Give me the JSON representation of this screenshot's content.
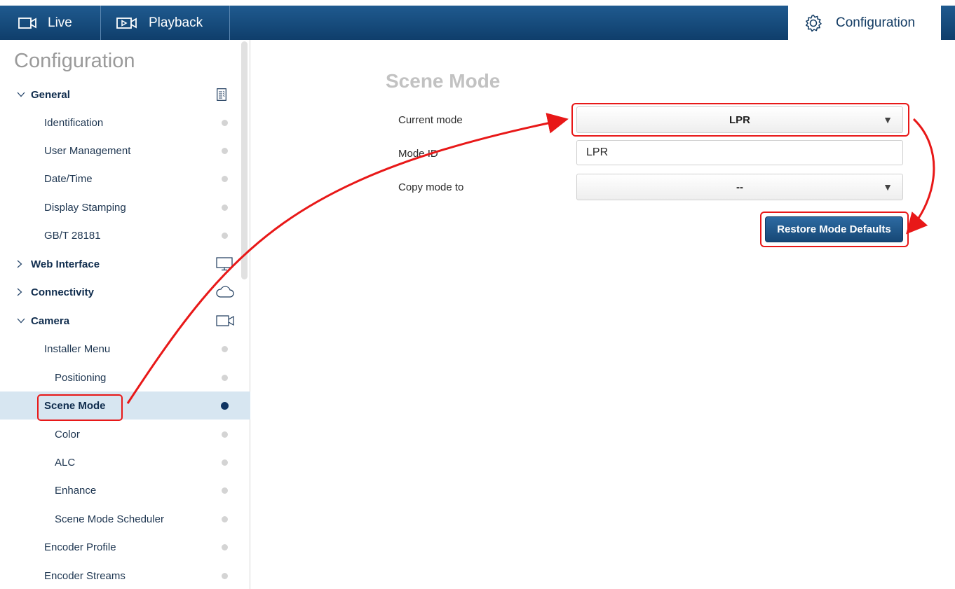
{
  "topbar": {
    "live_label": "Live",
    "playback_label": "Playback",
    "configuration_label": "Configuration"
  },
  "sidebar": {
    "title": "Configuration",
    "items": [
      {
        "label": "General",
        "type": "section",
        "expanded": true,
        "icon": "list-icon"
      },
      {
        "label": "Identification",
        "type": "item",
        "level": 1
      },
      {
        "label": "User Management",
        "type": "item",
        "level": 1
      },
      {
        "label": "Date/Time",
        "type": "item",
        "level": 1
      },
      {
        "label": "Display Stamping",
        "type": "item",
        "level": 1
      },
      {
        "label": "GB/T 28181",
        "type": "item",
        "level": 1
      },
      {
        "label": "Web Interface",
        "type": "section",
        "expanded": false,
        "icon": "monitor-icon"
      },
      {
        "label": "Connectivity",
        "type": "section",
        "expanded": false,
        "icon": "cloud-icon"
      },
      {
        "label": "Camera",
        "type": "section",
        "expanded": true,
        "icon": "camera-icon"
      },
      {
        "label": "Installer Menu",
        "type": "item",
        "level": 1
      },
      {
        "label": "Positioning",
        "type": "item",
        "level": 2
      },
      {
        "label": "Scene Mode",
        "type": "item",
        "level": 1,
        "active": true
      },
      {
        "label": "Color",
        "type": "item",
        "level": 2
      },
      {
        "label": "ALC",
        "type": "item",
        "level": 2
      },
      {
        "label": "Enhance",
        "type": "item",
        "level": 2
      },
      {
        "label": "Scene Mode Scheduler",
        "type": "item",
        "level": 2
      },
      {
        "label": "Encoder Profile",
        "type": "item",
        "level": 1
      },
      {
        "label": "Encoder Streams",
        "type": "item",
        "level": 1
      }
    ]
  },
  "main": {
    "title": "Scene Mode",
    "current_mode_label": "Current mode",
    "current_mode_value": "LPR",
    "mode_id_label": "Mode ID",
    "mode_id_value": "LPR",
    "copy_mode_label": "Copy mode to",
    "copy_mode_value": "--",
    "restore_button_label": "Restore Mode Defaults"
  },
  "colors": {
    "topbar": "#1a4f82",
    "active_item_bg": "#d7e6f1",
    "annotation": "#e81818"
  }
}
